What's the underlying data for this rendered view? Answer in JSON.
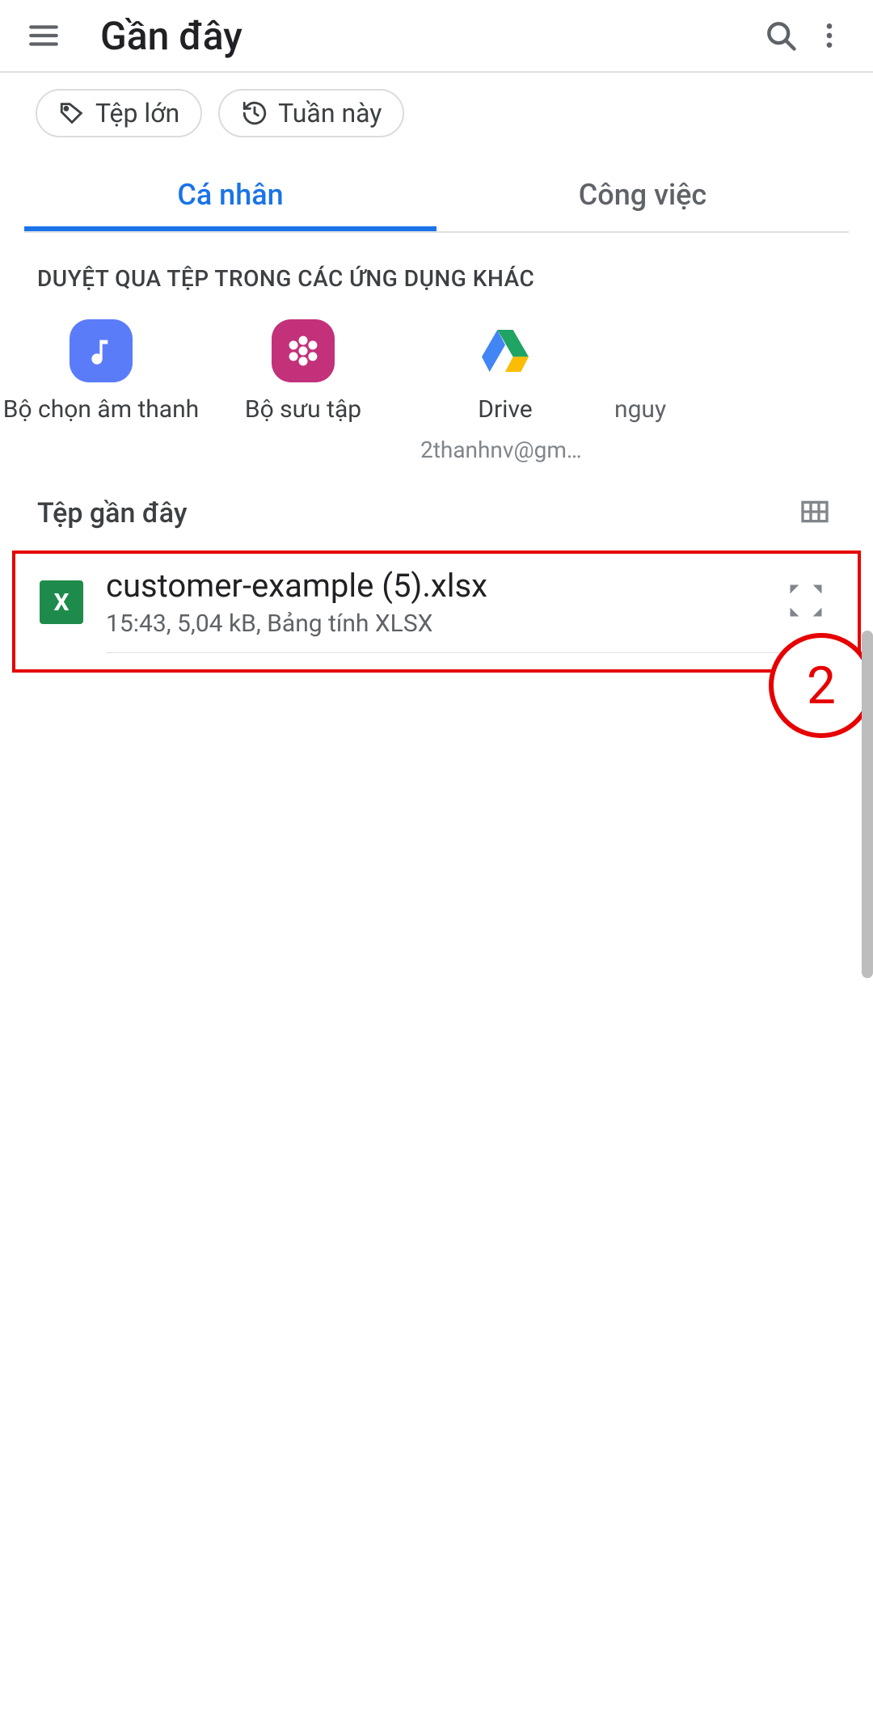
{
  "header": {
    "title": "Gần đây"
  },
  "chips": [
    {
      "label": "Tệp lớn"
    },
    {
      "label": "Tuần này"
    }
  ],
  "tabs": {
    "personal": "Cá nhân",
    "work": "Công việc"
  },
  "browse_label": "DUYỆT QUA TỆP TRONG CÁC ỨNG DỤNG KHÁC",
  "apps": [
    {
      "name": "Bộ chọn âm thanh",
      "sub": ""
    },
    {
      "name": "Bộ sưu tập",
      "sub": ""
    },
    {
      "name": "Drive",
      "sub": "2thanhnv@gmail...."
    },
    {
      "name": "nguy",
      "sub": ""
    }
  ],
  "recent": {
    "title": "Tệp gần đây",
    "files": [
      {
        "name": "customer-example (5).xlsx",
        "meta": "15:43, 5,04 kB, Bảng tính XLSX",
        "icon_letter": "X"
      }
    ]
  },
  "annotation": {
    "badge": "2"
  }
}
